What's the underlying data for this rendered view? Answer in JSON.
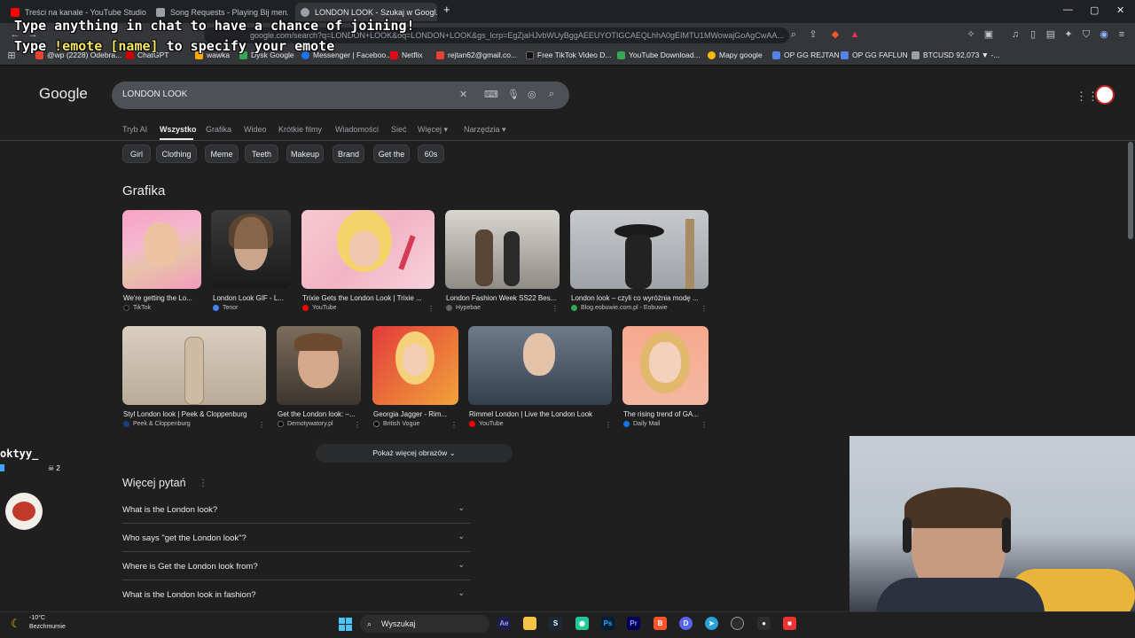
{
  "browser": {
    "tabs": [
      {
        "title": "Treści na kanale - YouTube Studio",
        "favicon_color": "#ff0000",
        "active": false
      },
      {
        "title": "Song Requests - Playing Bij men...",
        "favicon_color": "#9aa0a6",
        "active": false
      },
      {
        "title": "LONDON LOOK - Szukaj w Googl...",
        "favicon_color": "#9aa0a6",
        "active": true
      }
    ],
    "new_tab_label": "+",
    "url": "google.com/search?q=LONDON+LOOK&oq=LONDON+LOOK&gs_lcrp=EgZjaHJvbWUyBggAEEUYOTIGCAEQLhhA0gEIMTU1MWowajGoAgCwAA...",
    "window_controls": {
      "minimize": "—",
      "maximize": "▢",
      "close": "✕"
    }
  },
  "bookmarks": [
    {
      "label": "@wp (2228) Odebra...",
      "color": "#ea4335"
    },
    {
      "label": "ChatGPT",
      "color": "#9aa0a6"
    },
    {
      "label": "wawka",
      "color": "#f9ab00"
    },
    {
      "label": "Dysk Google",
      "color": "#34a853"
    },
    {
      "label": "Messenger | Faceboo...",
      "color": "#1877f2"
    },
    {
      "label": "Netflix",
      "color": "#e50914"
    },
    {
      "label": "rejtan62@gmail.co...",
      "color": "#ea4335"
    },
    {
      "label": "Free TikTok Video D...",
      "color": "#000000"
    },
    {
      "label": "YouTube Download...",
      "color": "#34a853"
    },
    {
      "label": "Mapy google",
      "color": "#fbbc04"
    },
    {
      "label": "OP GG REJTAN",
      "color": "#5383e8"
    },
    {
      "label": "OP GG FAFLUN",
      "color": "#5383e8"
    },
    {
      "label": "BTCUSD 92,073 ▼ -...",
      "color": "#9aa0a6"
    }
  ],
  "overlay": {
    "line1": "Type anything in chat to have a chance of joining!",
    "line2_prefix": "Type ",
    "line2_highlight": "!emote [name]",
    "line2_suffix": " to specify your emote"
  },
  "google": {
    "logo": "Google",
    "query": "LONDON LOOK",
    "tabs": [
      "Tryb AI",
      "Wszystko",
      "Grafika",
      "Wideo",
      "Krótkie filmy",
      "Wiadomości",
      "Sieć",
      "Więcej",
      "Narzędzia"
    ],
    "active_tab": "Wszystko",
    "chips": [
      "Girl",
      "Clothing",
      "Meme",
      "Teeth",
      "Makeup",
      "Brand",
      "Get the",
      "60s"
    ],
    "images_heading": "Grafika",
    "images": [
      {
        "title": "We're getting the Lo...",
        "source": "TikTok",
        "source_color": "#000000"
      },
      {
        "title": "London Look GIF - L...",
        "source": "Tenor",
        "source_color": "#4285f4"
      },
      {
        "title": "Trixie Gets the London Look | Trixie ...",
        "source": "YouTube",
        "source_color": "#ff0000"
      },
      {
        "title": "London Fashion Week SS22 Bes...",
        "source": "Hypebae",
        "source_color": "#5f6368"
      },
      {
        "title": "London look – czyli co wyróżnia modę ...",
        "source": "Blog.eobuwie.com.pl - Eobuwie",
        "source_color": "#34a853"
      },
      {
        "title": "Styl London look | Peek & Cloppenburg",
        "source": "Peek & Cloppenburg",
        "source_color": "#1a3d7c"
      },
      {
        "title": "Get the London look: –...",
        "source": "Demotywatory.pl",
        "source_color": "#000000"
      },
      {
        "title": "Georgia Jagger - Rim...",
        "source": "British Vogue",
        "source_color": "#000000"
      },
      {
        "title": "Rimmel London | Live the London Look",
        "source": "YouTube",
        "source_color": "#ff0000"
      },
      {
        "title": "The rising trend of GA...",
        "source": "Daily Mail",
        "source_color": "#1a73e8"
      }
    ],
    "show_more": "Pokaż więcej obrazów",
    "paa_heading": "Więcej pytań",
    "questions": [
      "What is the London look?",
      "Who says \"get the London look\"?",
      "Where is Get the London look from?",
      "What is the London look in fashion?"
    ]
  },
  "stream_chat": {
    "username": "oktyy_",
    "count": "2"
  },
  "taskbar": {
    "temperature": "-10°C",
    "weather": "Bezchmurnie",
    "search_placeholder": "Wyszukaj"
  }
}
